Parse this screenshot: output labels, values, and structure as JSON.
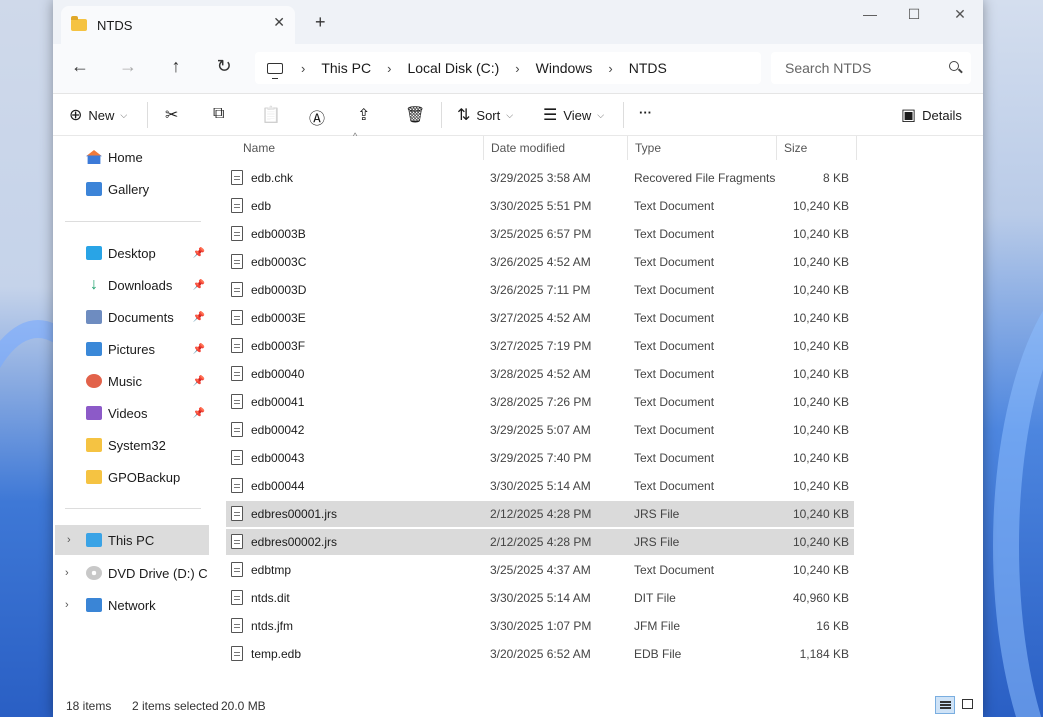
{
  "window": {
    "tab_title": "NTDS",
    "tab_close": "✕",
    "new_tab": "+",
    "controls": {
      "minimize": "—",
      "maximize": "☐",
      "close": "✕"
    }
  },
  "nav": {
    "back": "←",
    "forward": "→",
    "up": "↑",
    "refresh": "↻",
    "breadcrumbs": [
      "This PC",
      "Local Disk (C:)",
      "Windows",
      "NTDS"
    ],
    "separator": "›",
    "search_placeholder": "Search NTDS"
  },
  "toolbar": {
    "new_label": "New",
    "sort_label": "Sort",
    "view_label": "View",
    "more_label": "···",
    "details_label": "Details",
    "icons": {
      "new": "⊕",
      "cut": "✂",
      "copy": "⧉",
      "paste": "📋",
      "rename": "Ⓐ",
      "share": "⇪",
      "delete": "🗑",
      "sort": "⇅",
      "view": "☰",
      "details": "▣"
    }
  },
  "sidebar": {
    "items": [
      {
        "label": "Home",
        "icon": "home-icon"
      },
      {
        "label": "Gallery",
        "icon": "gallery-icon"
      },
      {
        "label": "Desktop",
        "icon": "desktop-icon",
        "pinned": true
      },
      {
        "label": "Downloads",
        "icon": "downloads-icon",
        "pinned": true
      },
      {
        "label": "Documents",
        "icon": "documents-icon",
        "pinned": true
      },
      {
        "label": "Pictures",
        "icon": "pictures-icon",
        "pinned": true
      },
      {
        "label": "Music",
        "icon": "music-icon",
        "pinned": true
      },
      {
        "label": "Videos",
        "icon": "videos-icon",
        "pinned": true
      },
      {
        "label": "System32",
        "icon": "folder-icon"
      },
      {
        "label": "GPOBackup",
        "icon": "folder-icon"
      },
      {
        "label": "This PC",
        "icon": "this-pc-icon",
        "selected": true
      },
      {
        "label": "DVD Drive (D:) CD_I",
        "icon": "dvd-drive-icon"
      },
      {
        "label": "Network",
        "icon": "network-icon"
      }
    ],
    "pin_glyph": "📌",
    "expand_glyph": "›"
  },
  "filelist": {
    "columns": {
      "name": "Name",
      "date": "Date modified",
      "type": "Type",
      "size": "Size"
    },
    "sort_caret": "^",
    "rows": [
      {
        "name": "edb.chk",
        "date": "3/29/2025 3:58 AM",
        "type": "Recovered File Fragments",
        "size": "8 KB"
      },
      {
        "name": "edb",
        "date": "3/30/2025 5:51 PM",
        "type": "Text Document",
        "size": "10,240 KB"
      },
      {
        "name": "edb0003B",
        "date": "3/25/2025 6:57 PM",
        "type": "Text Document",
        "size": "10,240 KB"
      },
      {
        "name": "edb0003C",
        "date": "3/26/2025 4:52 AM",
        "type": "Text Document",
        "size": "10,240 KB"
      },
      {
        "name": "edb0003D",
        "date": "3/26/2025 7:11 PM",
        "type": "Text Document",
        "size": "10,240 KB"
      },
      {
        "name": "edb0003E",
        "date": "3/27/2025 4:52 AM",
        "type": "Text Document",
        "size": "10,240 KB"
      },
      {
        "name": "edb0003F",
        "date": "3/27/2025 7:19 PM",
        "type": "Text Document",
        "size": "10,240 KB"
      },
      {
        "name": "edb00040",
        "date": "3/28/2025 4:52 AM",
        "type": "Text Document",
        "size": "10,240 KB"
      },
      {
        "name": "edb00041",
        "date": "3/28/2025 7:26 PM",
        "type": "Text Document",
        "size": "10,240 KB"
      },
      {
        "name": "edb00042",
        "date": "3/29/2025 5:07 AM",
        "type": "Text Document",
        "size": "10,240 KB"
      },
      {
        "name": "edb00043",
        "date": "3/29/2025 7:40 PM",
        "type": "Text Document",
        "size": "10,240 KB"
      },
      {
        "name": "edb00044",
        "date": "3/30/2025 5:14 AM",
        "type": "Text Document",
        "size": "10,240 KB"
      },
      {
        "name": "edbres00001.jrs",
        "date": "2/12/2025 4:28 PM",
        "type": "JRS File",
        "size": "10,240 KB",
        "selected": true
      },
      {
        "name": "edbres00002.jrs",
        "date": "2/12/2025 4:28 PM",
        "type": "JRS File",
        "size": "10,240 KB",
        "selected": true
      },
      {
        "name": "edbtmp",
        "date": "3/25/2025 4:37 AM",
        "type": "Text Document",
        "size": "10,240 KB"
      },
      {
        "name": "ntds.dit",
        "date": "3/30/2025 5:14 AM",
        "type": "DIT File",
        "size": "40,960 KB"
      },
      {
        "name": "ntds.jfm",
        "date": "3/30/2025 1:07 PM",
        "type": "JFM File",
        "size": "16 KB"
      },
      {
        "name": "temp.edb",
        "date": "3/20/2025 6:52 AM",
        "type": "EDB File",
        "size": "1,184 KB"
      }
    ]
  },
  "status": {
    "item_count": "18 items",
    "selection": "2 items selected",
    "selection_size": "20.0 MB"
  },
  "colors": {
    "selection_bg": "#dadada",
    "folder": "#f5c342",
    "accent": "#3a85d6"
  }
}
